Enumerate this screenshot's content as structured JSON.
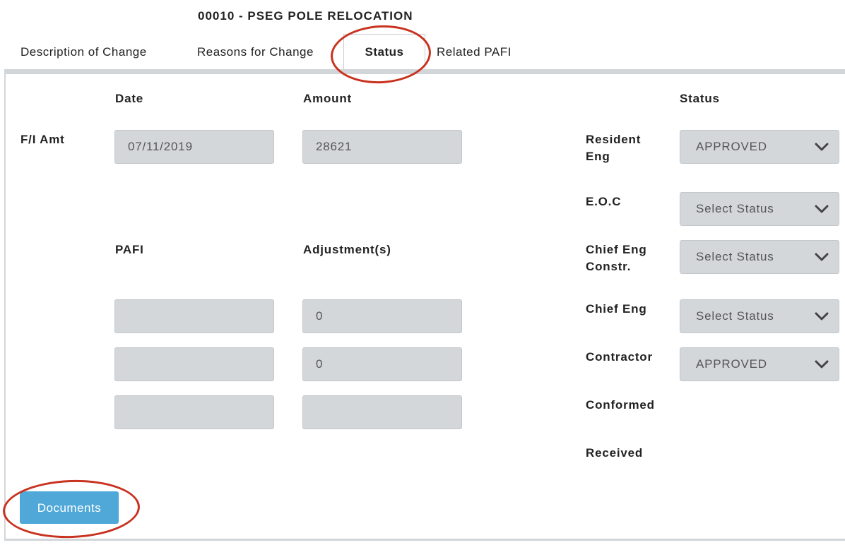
{
  "header": {
    "title": "00010 - PSEG POLE RELOCATION"
  },
  "tabs": [
    {
      "label": "Description of Change"
    },
    {
      "label": "Reasons for Change"
    },
    {
      "label": "Status",
      "active": true
    },
    {
      "label": "Related PAFI"
    }
  ],
  "columns": {
    "date": "Date",
    "amount": "Amount",
    "status": "Status",
    "pafi": "PAFI",
    "adjustments": "Adjustment(s)"
  },
  "fi_amt": {
    "label": "F/I Amt",
    "date_value": "07/11/2019",
    "amount_value": "28621"
  },
  "pafi_rows": [
    {
      "pafi": "",
      "adjustment": "0"
    },
    {
      "pafi": "",
      "adjustment": "0"
    },
    {
      "pafi": "",
      "adjustment": ""
    }
  ],
  "approvals": [
    {
      "label": "Resident Eng",
      "value": "APPROVED"
    },
    {
      "label": "E.O.C",
      "value": "Select Status"
    },
    {
      "label": "Chief Eng Constr.",
      "value": "Select Status"
    },
    {
      "label": "Chief Eng",
      "value": "Select Status"
    },
    {
      "label": "Contractor",
      "value": "APPROVED"
    },
    {
      "label": "Conformed"
    },
    {
      "label": "Received"
    }
  ],
  "buttons": {
    "documents": "Documents"
  },
  "colors": {
    "annotation_circle": "#c8331f",
    "button": "#4fa8d8",
    "field_bg": "#d4d7da"
  }
}
